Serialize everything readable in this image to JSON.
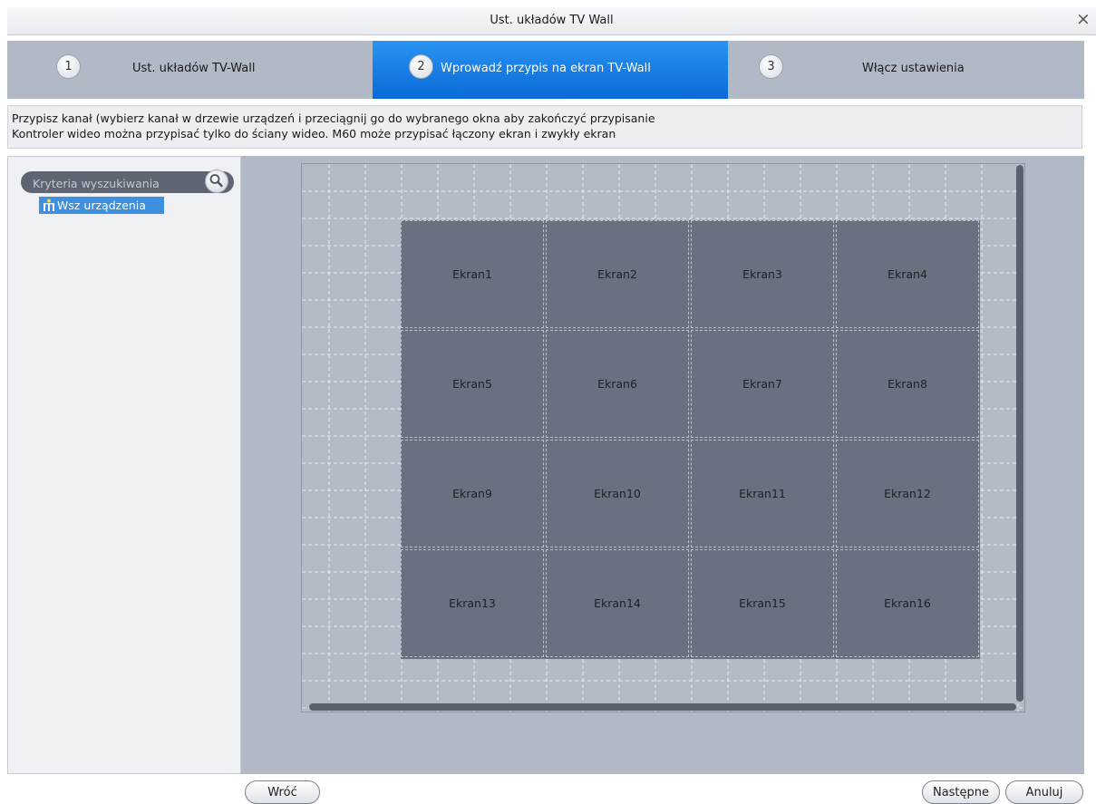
{
  "window": {
    "title": "Ust. układów TV Wall",
    "close_symbol": "×"
  },
  "steps": [
    {
      "number": "1",
      "label": "Ust. układów TV-Wall",
      "active": false
    },
    {
      "number": "2",
      "label": "Wprowadź przypis na ekran TV-Wall",
      "active": true
    },
    {
      "number": "3",
      "label": "Włącz ustawienia",
      "active": false
    }
  ],
  "info": {
    "line1": "Przypisz kanał (wybierz kanał w drzewie urządzeń i przeciągnij go do wybranego okna aby zakończyć przypisanie",
    "line2": "Kontroler wideo można przypisać tylko do ściany wideo. M60 może przypisać łączony ekran i zwykły ekran"
  },
  "search": {
    "placeholder": "Kryteria wyszukiwania",
    "icon": "search-icon"
  },
  "tree": {
    "root_label": "Wsz urządzenia",
    "icon": "device-tree-icon"
  },
  "screens": [
    "Ekran1",
    "Ekran2",
    "Ekran3",
    "Ekran4",
    "Ekran5",
    "Ekran6",
    "Ekran7",
    "Ekran8",
    "Ekran9",
    "Ekran10",
    "Ekran11",
    "Ekran12",
    "Ekran13",
    "Ekran14",
    "Ekran15",
    "Ekran16"
  ],
  "buttons": {
    "back": "Wróć",
    "next": "Następne",
    "cancel": "Anuluj"
  },
  "colors": {
    "active_step": "#1a7ee6",
    "panel_bg": "#b2b9c6",
    "screen_fill": "#6a7080",
    "selection": "#3d8fe0"
  }
}
